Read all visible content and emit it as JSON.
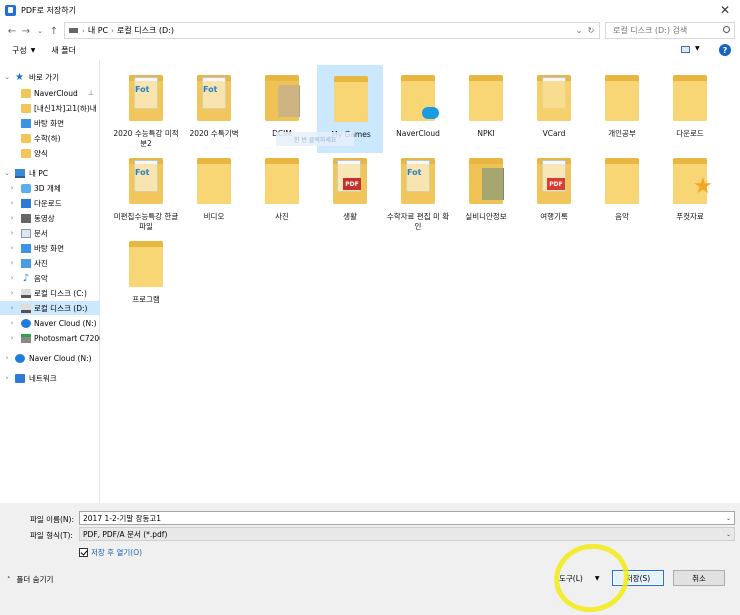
{
  "window": {
    "title": "PDF로 저장하기",
    "close_glyph": "✕"
  },
  "addressbar": {
    "crumbs": [
      "내 PC",
      "로컬 디스크 (D:)"
    ],
    "search_placeholder": "로컬 디스크 (D:) 검색"
  },
  "toolbar": {
    "organize_label": "구성",
    "new_folder_label": "새 폴더"
  },
  "sidebar": {
    "items": [
      {
        "label": "바로 가기",
        "icon": "star-icon",
        "expander": "chevron-down-icon"
      },
      {
        "label": "NaverCloud",
        "icon": "folder-icon",
        "pinned": true
      },
      {
        "label": "[내신1차]고1(하)내",
        "icon": "folder-icon"
      },
      {
        "label": "바탕 화면",
        "icon": "desktop-icon"
      },
      {
        "label": "수학(하)",
        "icon": "folder-icon"
      },
      {
        "label": "양식",
        "icon": "folder-icon"
      },
      {
        "label": "내 PC",
        "icon": "pc-icon",
        "expander": "chevron-down-icon"
      },
      {
        "label": "3D 개체",
        "icon": "3d-objects-icon",
        "expander": "chevron-right-icon"
      },
      {
        "label": "다운로드",
        "icon": "download-icon",
        "expander": "chevron-right-icon"
      },
      {
        "label": "동영상",
        "icon": "video-icon",
        "expander": "chevron-right-icon"
      },
      {
        "label": "문서",
        "icon": "document-icon",
        "expander": "chevron-right-icon"
      },
      {
        "label": "바탕 화면",
        "icon": "desktop-icon",
        "expander": "chevron-right-icon"
      },
      {
        "label": "사진",
        "icon": "pictures-icon",
        "expander": "chevron-right-icon"
      },
      {
        "label": "음악",
        "icon": "music-icon",
        "expander": "chevron-right-icon"
      },
      {
        "label": "로컬 디스크 (C:)",
        "icon": "drive-icon",
        "expander": "chevron-right-icon"
      },
      {
        "label": "로컬 디스크 (D:)",
        "icon": "drive-icon",
        "expander": "chevron-right-icon",
        "selected": true
      },
      {
        "label": "Naver Cloud (N:)",
        "icon": "cloud-drive-icon",
        "expander": "chevron-right-icon"
      },
      {
        "label": "Photosmart C7200",
        "icon": "printer-icon",
        "expander": "chevron-right-icon"
      },
      {
        "label": "Naver Cloud (N:)",
        "icon": "cloud-drive-icon",
        "expander": "chevron-right-icon"
      },
      {
        "label": "네트워크",
        "icon": "network-icon",
        "expander": "chevron-right-icon"
      }
    ],
    "pin_glyph": "📌"
  },
  "content": {
    "items": [
      {
        "label": "2020 수능특강 미적분2",
        "icon": "fot-folder-icon"
      },
      {
        "label": "2020 수특기벽",
        "icon": "fot-folder-icon"
      },
      {
        "label": "DCIM",
        "icon": "photo-folder-icon"
      },
      {
        "label": "My Games",
        "icon": "folder-icon",
        "selected": true
      },
      {
        "label": "NaverCloud",
        "icon": "cloud-folder-icon"
      },
      {
        "label": "NPKI",
        "icon": "folder-icon"
      },
      {
        "label": "VCard",
        "icon": "folder-icon"
      },
      {
        "label": "개인공부",
        "icon": "folder-icon"
      },
      {
        "label": "다운로드",
        "icon": "folder-icon"
      },
      {
        "label": "미편집수능특강 한글파일",
        "icon": "fot-folder-icon"
      },
      {
        "label": "비디오",
        "icon": "folder-icon"
      },
      {
        "label": "사진",
        "icon": "folder-icon"
      },
      {
        "label": "생활",
        "icon": "pdf-folder-icon"
      },
      {
        "label": "수학자료 편집 미 확인",
        "icon": "fot-folder-icon"
      },
      {
        "label": "실비니안정보",
        "icon": "image-folder-icon"
      },
      {
        "label": "여행기록",
        "icon": "pdf-folder-icon"
      },
      {
        "label": "음악",
        "icon": "folder-icon"
      },
      {
        "label": "푸컷자료",
        "icon": "star-folder-icon"
      },
      {
        "label": "프로그램",
        "icon": "folder-icon"
      }
    ],
    "drag_hint": "한 번 클릭하세요"
  },
  "bottom": {
    "filename_label": "파일 이름(N):",
    "filename_value": "2017 1-2-기말 장동고1",
    "filetype_label": "파일 형식(T):",
    "filetype_value": "PDF, PDF/A 문서 (*.pdf)",
    "view_after_save_label": "저장 후 열기(O)",
    "view_after_save_checked": true,
    "hide_folders_label": "폴더 숨기기",
    "tools_label": "도구(L)",
    "save_label": "저장(S)",
    "cancel_label": "취소"
  },
  "annotation": {
    "highlight_color": "#f2ec13"
  }
}
